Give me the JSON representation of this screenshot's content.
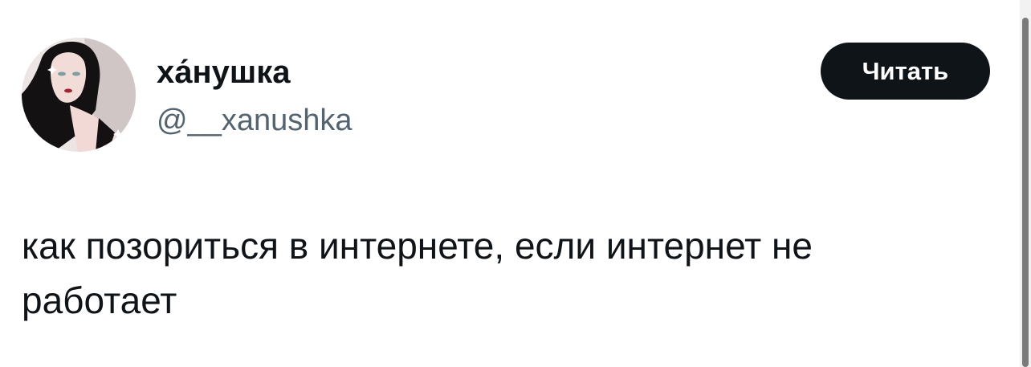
{
  "author": {
    "display_name": "ха́нушка",
    "handle": "@__xanushka",
    "avatar_icon": "avatar-portrait"
  },
  "actions": {
    "follow_label": "Читать"
  },
  "tweet": {
    "line1": "как позориться в интернете, если интернет не",
    "line2": "работает"
  },
  "colors": {
    "text": "#0f1419",
    "secondary": "#536471",
    "button_bg": "#0f1419",
    "button_text": "#ffffff"
  }
}
